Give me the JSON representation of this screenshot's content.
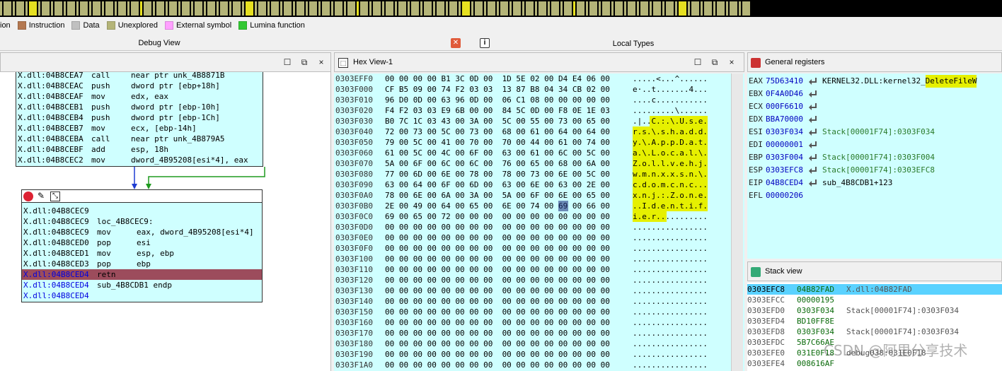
{
  "legend": [
    {
      "label": "ion",
      "color": ""
    },
    {
      "label": "Instruction",
      "color": "#b47850"
    },
    {
      "label": "Data",
      "color": "#c0c0c0"
    },
    {
      "label": "Unexplored",
      "color": "#b4b478"
    },
    {
      "label": "External symbol",
      "color": "#ffa0ff"
    },
    {
      "label": "Lumina function",
      "color": "#32c832"
    }
  ],
  "tabs": {
    "debug_view": "Debug View",
    "local_types": "Local Types",
    "close_icon": "close-icon",
    "info_icon": "info-icon"
  },
  "debug_header": {
    "controls": [
      "☐",
      "⧉",
      "×"
    ]
  },
  "top_block": {
    "lines": [
      {
        "addr": "X.dll:04B8CEA7",
        "mn": "call",
        "op": "near ptr unk_4B8871B"
      },
      {
        "addr": "X.dll:04B8CEAC",
        "mn": "push",
        "op": "dword ptr [ebp+18h]"
      },
      {
        "addr": "X.dll:04B8CEAF",
        "mn": "mov",
        "op": "edx, eax"
      },
      {
        "addr": "X.dll:04B8CEB1",
        "mn": "push",
        "op": "dword ptr [ebp-10h]"
      },
      {
        "addr": "X.dll:04B8CEB4",
        "mn": "push",
        "op": "dword ptr [ebp-1Ch]"
      },
      {
        "addr": "X.dll:04B8CEB7",
        "mn": "mov",
        "op": "ecx, [ebp-14h]"
      },
      {
        "addr": "X.dll:04B8CEBA",
        "mn": "call",
        "op": "near ptr unk_4B879A5"
      },
      {
        "addr": "X.dll:04B8CEBF",
        "mn": "add",
        "op": "esp, 18h"
      },
      {
        "addr": "X.dll:04B8CEC2",
        "mn": "mov",
        "op": "dword_4B95208[esi*4], eax"
      }
    ]
  },
  "bottom_block": {
    "lines": [
      {
        "addr": "X.dll:04B8CEC9",
        "mn": "",
        "op": ""
      },
      {
        "addr": "X.dll:04B8CEC9",
        "mn": "loc_4B8CEC9:",
        "op": ""
      },
      {
        "addr": "X.dll:04B8CEC9",
        "mn": "mov",
        "op": "eax, dword_4B95208[esi*4]"
      },
      {
        "addr": "X.dll:04B8CED0",
        "mn": "pop",
        "op": "esi"
      },
      {
        "addr": "X.dll:04B8CED1",
        "mn": "mov",
        "op": "esp, ebp"
      },
      {
        "addr": "X.dll:04B8CED3",
        "mn": "pop",
        "op": "ebp"
      },
      {
        "addr": "X.dll:04B8CED4",
        "mn": "retn",
        "op": ""
      },
      {
        "addr": "X.dll:04B8CED4",
        "mn": "sub_4B8CDB1 endp",
        "op": ""
      },
      {
        "addr": "X.dll:04B8CED4",
        "mn": "",
        "op": ""
      }
    ]
  },
  "hex_view": {
    "title": "Hex View-1",
    "rows": [
      {
        "a": "0303EFF0",
        "b": "00 00 00 00 B1 3C 0D 00  1D 5E 02 00 D4 E4 06 00",
        "c": ".....<...^......"
      },
      {
        "a": "0303F000",
        "b": "CF B5 09 00 74 F2 03 03  13 87 B8 04 34 CB 02 00",
        "c": "e·..t.......4..."
      },
      {
        "a": "0303F010",
        "b": "96 D0 0D 00 63 96 0D 00  06 C1 08 00 00 00 00 00",
        "c": "....c..........."
      },
      {
        "a": "0303F020",
        "b": "F4 F2 03 03 E9 6B 00 00  84 5C 0D 00 F8 0E 1E 03",
        "c": ".........\\......"
      },
      {
        "a": "0303F030",
        "b": "B0 7C 1C 03 43 00 3A 00  5C 00 55 00 73 00 65 00",
        "c": ".|..C.:.\\.U.s.e."
      },
      {
        "a": "0303F040",
        "b": "72 00 73 00 5C 00 73 00  68 00 61 00 64 00 64 00",
        "c": "r.s.\\.s.h.a.d.d."
      },
      {
        "a": "0303F050",
        "b": "79 00 5C 00 41 00 70 00  70 00 44 00 61 00 74 00",
        "c": "y.\\.A.p.p.D.a.t."
      },
      {
        "a": "0303F060",
        "b": "61 00 5C 00 4C 00 6F 00  63 00 61 00 6C 00 5C 00",
        "c": "a.\\.L.o.c.a.l.\\."
      },
      {
        "a": "0303F070",
        "b": "5A 00 6F 00 6C 00 6C 00  76 00 65 00 68 00 6A 00",
        "c": "Z.o.l.l.v.e.h.j."
      },
      {
        "a": "0303F080",
        "b": "77 00 6D 00 6E 00 78 00  78 00 73 00 6E 00 5C 00",
        "c": "w.m.n.x.x.s.n.\\."
      },
      {
        "a": "0303F090",
        "b": "63 00 64 00 6F 00 6D 00  63 00 6E 00 63 00 2E 00",
        "c": "c.d.o.m.c.n.c..."
      },
      {
        "a": "0303F0A0",
        "b": "78 00 6E 00 6A 00 3A 00  5A 00 6F 00 6E 00 65 00",
        "c": "x.n.j.:.Z.o.n.e."
      },
      {
        "a": "0303F0B0",
        "b": "2E 00 49 00 64 00 65 00  6E 00 74 00 69 00 66 00",
        "c": "..I.d.e.n.t.i.f."
      },
      {
        "a": "0303F0C0",
        "b": "69 00 65 00 72 00 00 00  00 00 00 00 00 00 00 00",
        "c": "i.e.r..........."
      },
      {
        "a": "0303F0D0",
        "b": "00 00 00 00 00 00 00 00  00 00 00 00 00 00 00 00",
        "c": "................"
      },
      {
        "a": "0303F0E0",
        "b": "00 00 00 00 00 00 00 00  00 00 00 00 00 00 00 00",
        "c": "................"
      },
      {
        "a": "0303F0F0",
        "b": "00 00 00 00 00 00 00 00  00 00 00 00 00 00 00 00",
        "c": "................"
      },
      {
        "a": "0303F100",
        "b": "00 00 00 00 00 00 00 00  00 00 00 00 00 00 00 00",
        "c": "................"
      },
      {
        "a": "0303F110",
        "b": "00 00 00 00 00 00 00 00  00 00 00 00 00 00 00 00",
        "c": "................"
      },
      {
        "a": "0303F120",
        "b": "00 00 00 00 00 00 00 00  00 00 00 00 00 00 00 00",
        "c": "................"
      },
      {
        "a": "0303F130",
        "b": "00 00 00 00 00 00 00 00  00 00 00 00 00 00 00 00",
        "c": "................"
      },
      {
        "a": "0303F140",
        "b": "00 00 00 00 00 00 00 00  00 00 00 00 00 00 00 00",
        "c": "................"
      },
      {
        "a": "0303F150",
        "b": "00 00 00 00 00 00 00 00  00 00 00 00 00 00 00 00",
        "c": "................"
      },
      {
        "a": "0303F160",
        "b": "00 00 00 00 00 00 00 00  00 00 00 00 00 00 00 00",
        "c": "................"
      },
      {
        "a": "0303F170",
        "b": "00 00 00 00 00 00 00 00  00 00 00 00 00 00 00 00",
        "c": "................"
      },
      {
        "a": "0303F180",
        "b": "00 00 00 00 00 00 00 00  00 00 00 00 00 00 00 00",
        "c": "................"
      },
      {
        "a": "0303F190",
        "b": "00 00 00 00 00 00 00 00  00 00 00 00 00 00 00 00",
        "c": "................"
      },
      {
        "a": "0303F1A0",
        "b": "00 00 00 00 00 00 00 00  00 00 00 00 00 00 00 00",
        "c": "................"
      }
    ]
  },
  "registers": {
    "title": "General registers",
    "rows": [
      {
        "name": "EAX",
        "value": "75D63410",
        "desc": "KERNEL32.DLL:kernel32_",
        "hl": "DeleteFileW"
      },
      {
        "name": "EBX",
        "value": "0F4A0D46",
        "desc": "",
        "hl": ""
      },
      {
        "name": "ECX",
        "value": "000F6610",
        "desc": "",
        "hl": ""
      },
      {
        "name": "EDX",
        "value": "BBA70000",
        "desc": "",
        "hl": ""
      },
      {
        "name": "ESI",
        "value": "0303F034",
        "desc": "Stack[00001F74]:0303F034",
        "hl": ""
      },
      {
        "name": "EDI",
        "value": "00000001",
        "desc": "",
        "hl": ""
      },
      {
        "name": "EBP",
        "value": "0303F004",
        "desc": "Stack[00001F74]:0303F004",
        "hl": ""
      },
      {
        "name": "ESP",
        "value": "0303EFC8",
        "desc": "Stack[00001F74]:0303EFC8",
        "hl": ""
      },
      {
        "name": "EIP",
        "value": "04B8CED4",
        "desc": "sub_4B8CDB1+123",
        "hl": ""
      },
      {
        "name": "EFL",
        "value": "00000206",
        "desc": "",
        "hl": ""
      }
    ]
  },
  "stack_view": {
    "title": "Stack view",
    "rows": [
      {
        "addr": "0303EFC8",
        "val": "04B82FAD",
        "desc": "X.dll:04B82FAD"
      },
      {
        "addr": "0303EFCC",
        "val": "00000195",
        "desc": ""
      },
      {
        "addr": "0303EFD0",
        "val": "0303F034",
        "desc": "Stack[00001F74]:0303F034"
      },
      {
        "addr": "0303EFD4",
        "val": "BD10FF8E",
        "desc": ""
      },
      {
        "addr": "0303EFD8",
        "val": "0303F034",
        "desc": "Stack[00001F74]:0303F034"
      },
      {
        "addr": "0303EFDC",
        "val": "5B7C66AE",
        "desc": ""
      },
      {
        "addr": "0303EFE0",
        "val": "031E0F18",
        "desc": "debug038:031E0F18"
      },
      {
        "addr": "0303EFE4",
        "val": "008616AF",
        "desc": ""
      }
    ]
  },
  "watermark": "CSDN @阿里分享技术",
  "colors": {
    "panel_bg": "#cfffff",
    "highlight_yellow": "#e6f000",
    "retn_row": "#9c4c5c",
    "stack_active": "#5ad2ff"
  }
}
